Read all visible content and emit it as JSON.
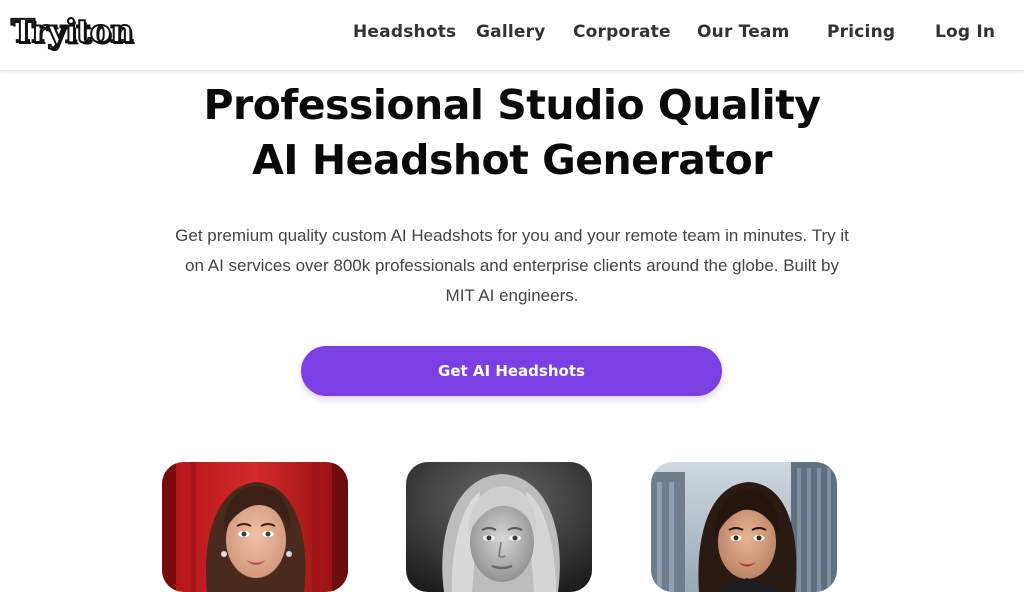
{
  "brand": {
    "logo_text": "Tryiton"
  },
  "nav": {
    "items": [
      {
        "label": "Headshots"
      },
      {
        "label": "Gallery"
      },
      {
        "label": "Corporate"
      },
      {
        "label": "Our Team"
      },
      {
        "label": "Pricing"
      },
      {
        "label": "Log In"
      }
    ]
  },
  "hero": {
    "title_line1": "Professional Studio Quality",
    "title_line2": "AI Headshot Generator",
    "subtitle": "Get premium quality custom AI Headshots for you and your remote team in minutes. Try it on AI services over 800k professionals and enterprise clients around the globe. Built by MIT AI engineers.",
    "cta_label": "Get AI Headshots"
  },
  "colors": {
    "accent": "#7b3fe4",
    "text": "#0a0a0a",
    "muted": "#444444"
  },
  "gallery": {
    "photos": [
      {
        "name": "headshot-woman-red-carpet"
      },
      {
        "name": "headshot-woman-black-white"
      },
      {
        "name": "headshot-woman-city"
      }
    ]
  }
}
